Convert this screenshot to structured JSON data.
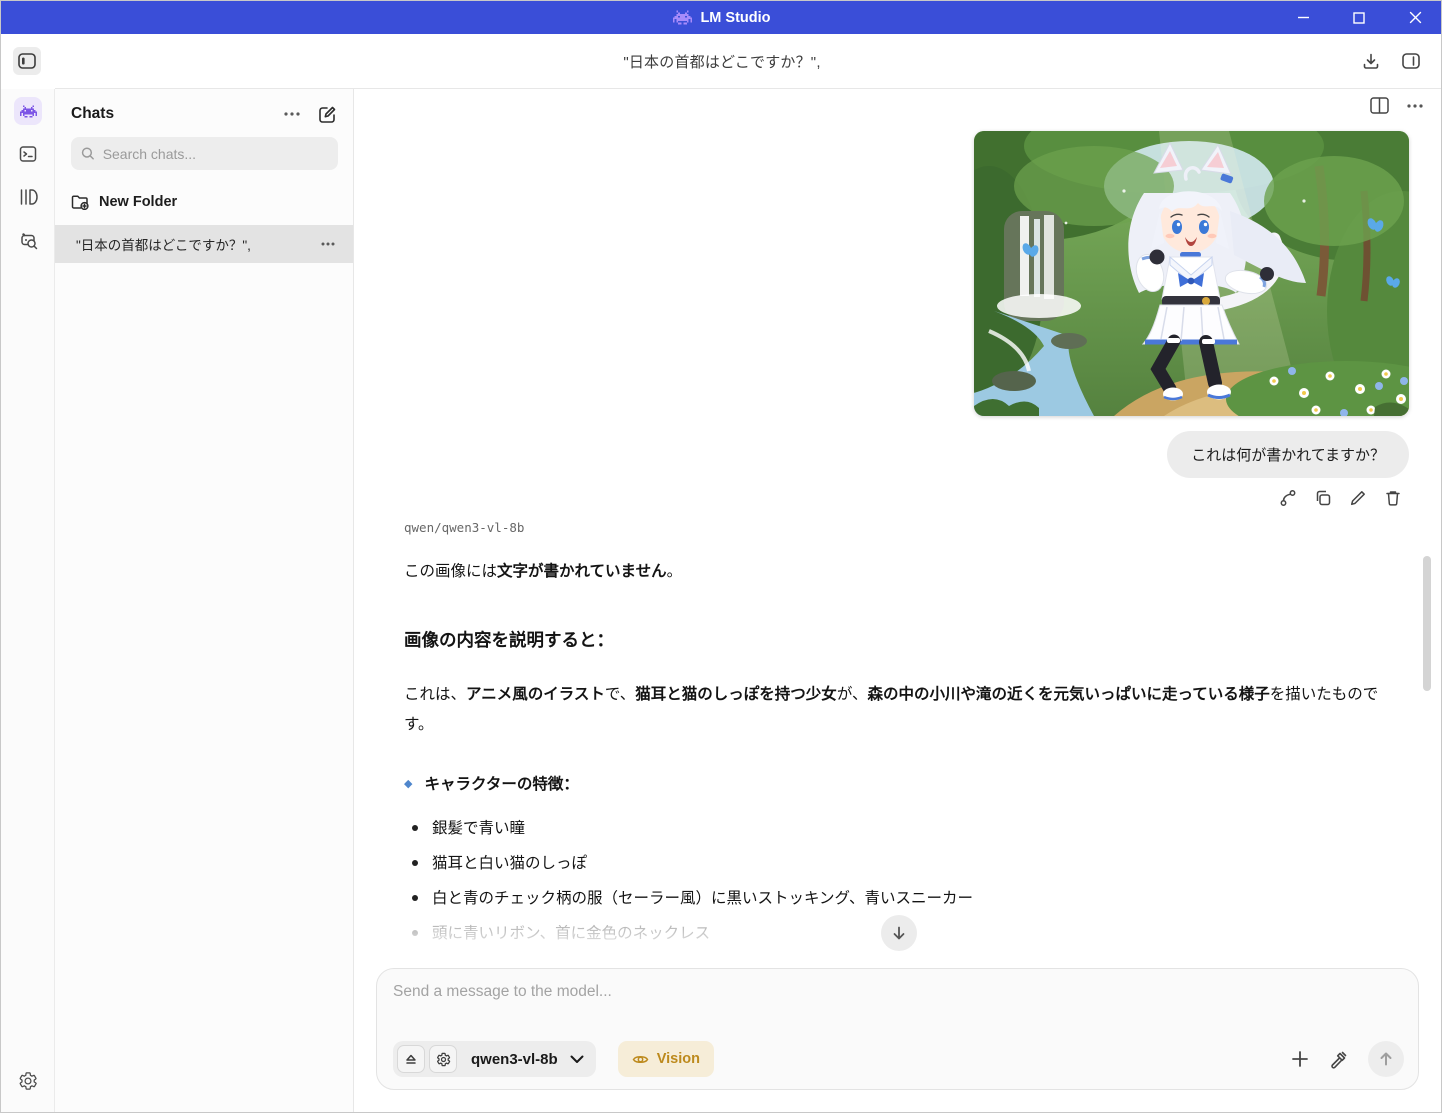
{
  "app": {
    "title": "LM Studio"
  },
  "colors": {
    "titlebar_blue": "#3a4ed8",
    "accent_purple": "#7c55e6",
    "vision_amber": "#bd8a1d",
    "bubble_gray": "#ececec",
    "diamond_blue": "#4f86cc"
  },
  "header": {
    "title": "\"日本の首都はどこですか？\","
  },
  "sidebar": {
    "title": "Chats",
    "search_placeholder": "Search chats...",
    "new_folder_label": "New Folder",
    "chats": [
      {
        "title": "\"日本の首都はどこですか？\",",
        "selected": true
      }
    ]
  },
  "conversation": {
    "user": {
      "attachment": "anime cat-girl running through forest near waterfall",
      "bubble_text": "これは何が書かれてますか？"
    },
    "assistant": {
      "model_name": "qwen/qwen3-vl-8b",
      "blocks": [
        {
          "type": "p",
          "segments": [
            {
              "text": "この画像には"
            },
            {
              "text": "文字が書かれていません",
              "bold": true
            },
            {
              "text": "。"
            }
          ]
        },
        {
          "type": "h",
          "text": "画像の内容を説明すると："
        },
        {
          "type": "p",
          "segments": [
            {
              "text": "これは、"
            },
            {
              "text": "アニメ風のイラスト",
              "bold": true
            },
            {
              "text": "で、"
            },
            {
              "text": "猫耳と猫のしっぽを持つ少女",
              "bold": true
            },
            {
              "text": "が、"
            },
            {
              "text": "森の中の小川や滝の近くを元気いっぱいに走っている様子",
              "bold": true
            },
            {
              "text": "を描いたものです。"
            }
          ]
        },
        {
          "type": "diamond",
          "text": "キャラクターの特徴："
        },
        {
          "type": "ul",
          "items": [
            {
              "text": "銀髪で青い瞳"
            },
            {
              "text": "猫耳と白い猫のしっぽ"
            },
            {
              "text": "白と青のチェック柄の服（セーラー風）に黒いストッキング、青いスニーカー"
            },
            {
              "text": "頭に青いリボン、首に金色のネックレス",
              "faded": true
            }
          ]
        }
      ]
    }
  },
  "composer": {
    "placeholder": "Send a message to the model...",
    "model_chip": {
      "label": "qwen3-vl-8b"
    },
    "vision_badge": "Vision"
  }
}
